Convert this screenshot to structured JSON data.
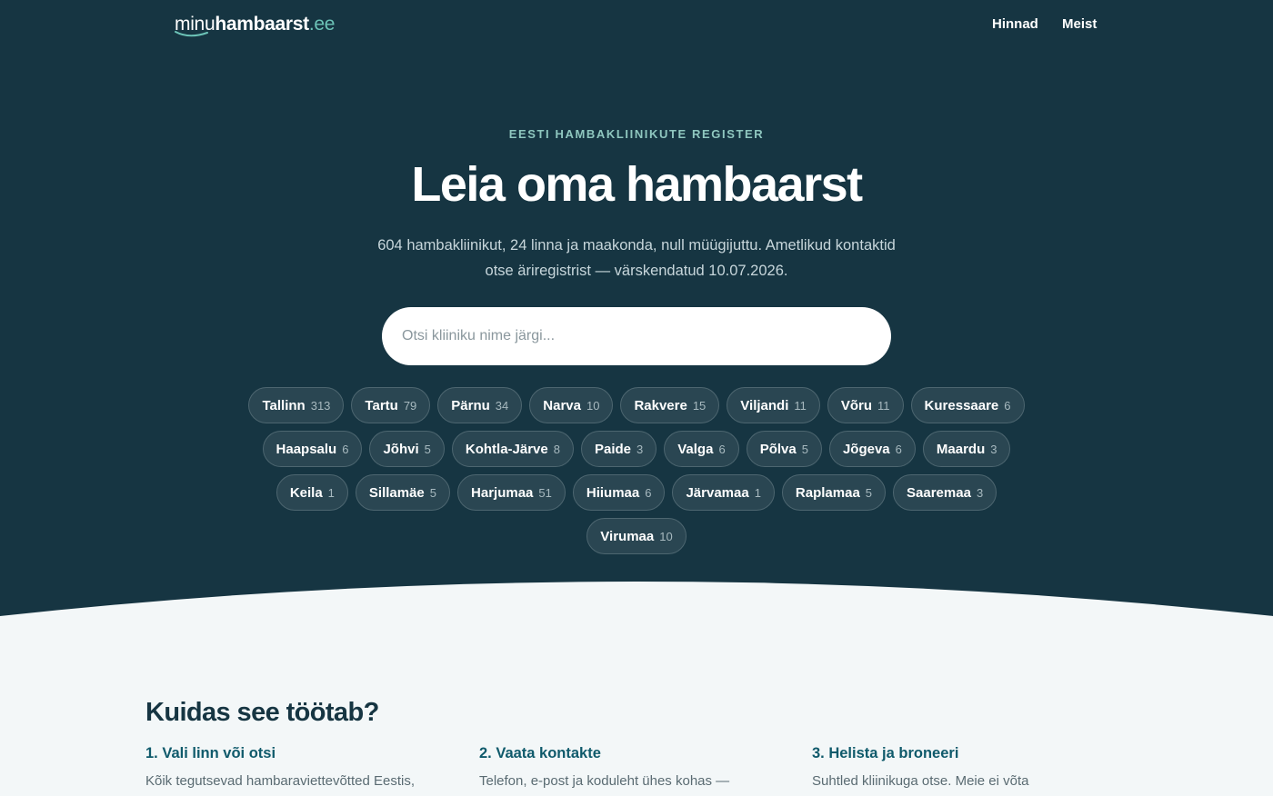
{
  "brand": {
    "part1": "minu",
    "part2": "hambaarst",
    "part3": ".ee"
  },
  "nav": {
    "prices": "Hinnad",
    "about": "Meist"
  },
  "hero": {
    "eyebrow": "EESTI HAMBAKLIINIKUTE REGISTER",
    "title": "Leia oma hambaarst",
    "subtitle": "604 hambakliinikut, 24 linna ja maakonda, null müügijuttu. Ametlikud kontaktid otse äriregistrist — värskendatud 10.07.2026.",
    "search_placeholder": "Otsi kliiniku nime järgi..."
  },
  "cities": [
    {
      "name": "Tallinn",
      "count": "313"
    },
    {
      "name": "Tartu",
      "count": "79"
    },
    {
      "name": "Pärnu",
      "count": "34"
    },
    {
      "name": "Narva",
      "count": "10"
    },
    {
      "name": "Rakvere",
      "count": "15"
    },
    {
      "name": "Viljandi",
      "count": "11"
    },
    {
      "name": "Võru",
      "count": "11"
    },
    {
      "name": "Kuressaare",
      "count": "6"
    },
    {
      "name": "Haapsalu",
      "count": "6"
    },
    {
      "name": "Jõhvi",
      "count": "5"
    },
    {
      "name": "Kohtla-Järve",
      "count": "8"
    },
    {
      "name": "Paide",
      "count": "3"
    },
    {
      "name": "Valga",
      "count": "6"
    },
    {
      "name": "Põlva",
      "count": "5"
    },
    {
      "name": "Jõgeva",
      "count": "6"
    },
    {
      "name": "Maardu",
      "count": "3"
    },
    {
      "name": "Keila",
      "count": "1"
    },
    {
      "name": "Sillamäe",
      "count": "5"
    },
    {
      "name": "Harjumaa",
      "count": "51"
    },
    {
      "name": "Hiiumaa",
      "count": "6"
    },
    {
      "name": "Järvamaa",
      "count": "1"
    },
    {
      "name": "Raplamaa",
      "count": "5"
    },
    {
      "name": "Saaremaa",
      "count": "3"
    },
    {
      "name": "Virumaa",
      "count": "10"
    }
  ],
  "how": {
    "title": "Kuidas see töötab?",
    "steps": [
      {
        "title": "1. Vali linn või otsi",
        "text": "Kõik tegutsevad hambaraviettevõtted Eestis,"
      },
      {
        "title": "2. Vaata kontakte",
        "text": "Telefon, e-post ja koduleht ühes kohas —"
      },
      {
        "title": "3. Helista ja broneeri",
        "text": "Suhtled kliinikuga otse. Meie ei võta"
      }
    ]
  },
  "colors": {
    "hero_bg": "#163542",
    "accent": "#6cc3b7",
    "page_bg": "#f3f7f8",
    "step_title": "#0f5a6b"
  }
}
